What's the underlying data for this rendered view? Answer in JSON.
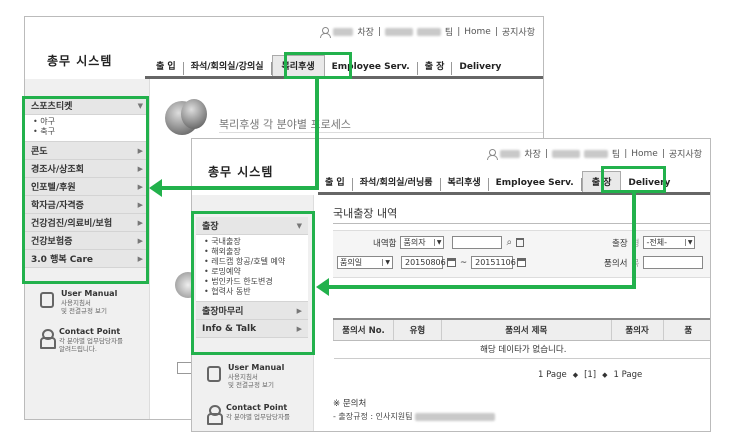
{
  "colors": {
    "highlight": "#22b14c"
  },
  "window1": {
    "topbar": {
      "role": "차장",
      "home": "Home",
      "notice": "공지사항",
      "dept_suffix": "팀"
    },
    "logo": "총무 시스템",
    "nav": [
      {
        "label": "출 입"
      },
      {
        "label": "좌석/회의실/강의실"
      },
      {
        "label": "복리후생",
        "active": true
      },
      {
        "label": "Employee Serv."
      },
      {
        "label": "출 장"
      },
      {
        "label": "Delivery"
      }
    ],
    "page_title": "복리후생 각 분야별 프로세스",
    "menu": [
      {
        "label": "스포츠티켓",
        "expanded": true,
        "sub": [
          "• 야구",
          "• 축구"
        ]
      },
      {
        "label": "콘도"
      },
      {
        "label": "경조사/상조회"
      },
      {
        "label": "인포텔/후원"
      },
      {
        "label": "학자금/자격증"
      },
      {
        "label": "건강검진/의료비/보험"
      },
      {
        "label": "건강보험증"
      },
      {
        "label": "3.0 행복 Care"
      }
    ],
    "help": [
      {
        "title": "User Manual",
        "sub": "사용지침서\n및 전결규정 보기",
        "icon": "manual-icon"
      },
      {
        "title": "Contact Point",
        "sub": "각 분야별 업무담당자를\n알려드립니다.",
        "icon": "contact-person-icon"
      }
    ]
  },
  "window2": {
    "topbar": {
      "role": "차장",
      "home": "Home",
      "notice": "공지사항",
      "dept_suffix": "팀"
    },
    "logo": "총무 시스템",
    "nav": [
      {
        "label": "출 입"
      },
      {
        "label": "좌석/회의실/러닝룸"
      },
      {
        "label": "복리후생"
      },
      {
        "label": "Employee Serv."
      },
      {
        "label": "출 장",
        "active": true
      },
      {
        "label": "Delivery"
      }
    ],
    "page_title": "국내출장 내역",
    "menu": [
      {
        "label": "출장",
        "expanded": true,
        "sub": [
          "• 국내출장",
          "• 해외출장",
          "• 레드캡 항공/호텔 예약",
          "• 로밍예약",
          "• 법인카드 한도변경",
          "• 협력사 동반"
        ]
      },
      {
        "label": "출장마무리"
      },
      {
        "label": "Info & Talk"
      }
    ],
    "help": [
      {
        "title": "User Manual",
        "sub": "사용지침서\n및 전결규정 보기",
        "icon": "manual-icon"
      },
      {
        "title": "Contact Point",
        "sub": "각 분야별 업무담당자를",
        "icon": "contact-person-icon"
      }
    ],
    "search": {
      "label_list": "내역함",
      "select_list": "품의자",
      "label_trip": "출장",
      "label_trip2": "형",
      "select_trip": "-전체-",
      "select_date": "품의일",
      "date_from": "20150806",
      "tilde": "~",
      "date_to": "20151106",
      "label_doc": "품의서",
      "label_doc2": "목"
    },
    "table": {
      "headers": [
        "품의서 No.",
        "유형",
        "품의서 제목",
        "품의자",
        "품"
      ],
      "empty": "해당 데이타가 없습니다."
    },
    "pager": {
      "first": "1 Page",
      "current": "[1]",
      "last": "1 Page"
    },
    "contact": {
      "heading": "※ 문의처",
      "line": "- 출장규정 : 인사지원팀"
    }
  }
}
